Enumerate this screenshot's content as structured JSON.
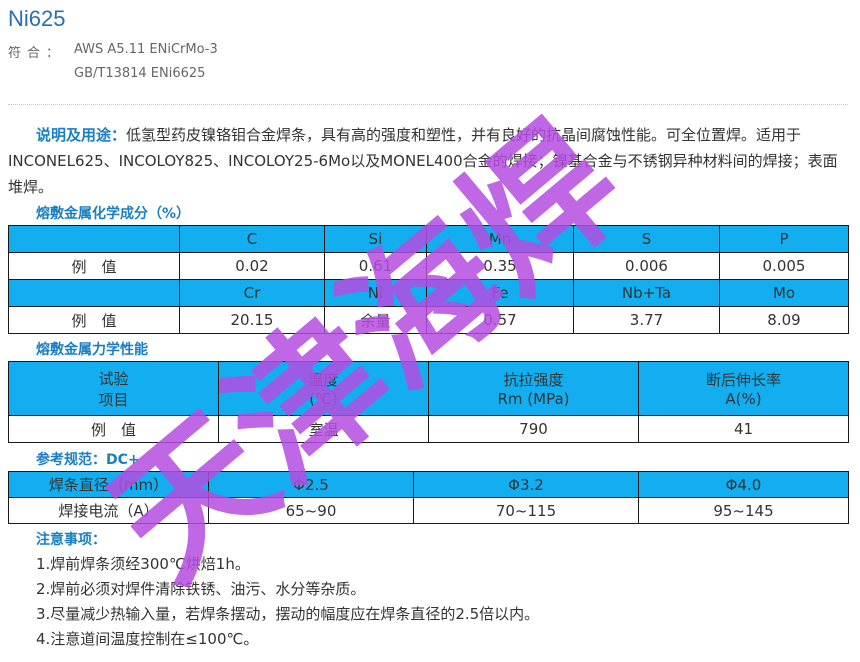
{
  "title": "Ni625",
  "spec": {
    "label": "符合：",
    "line1": "AWS A5.11 ENiCrMo-3",
    "line2": "GB/T13814 ENi6625"
  },
  "description": {
    "lead": "说明及用途：",
    "text": "低氢型药皮镍铬钼合金焊条，具有高的强度和塑性，并有良好的抗晶间腐蚀性能。可全位置焊。适用于INCONEL625、INCOLOY825、INCOLOY25-6Mo以及MONEL400合金的焊接；镍基合金与不锈钢异种材料间的焊接；表面堆焊。"
  },
  "chem": {
    "title": "熔敷金属化学成分（%）",
    "rows": [
      {
        "type": "hd",
        "cells": [
          "",
          "C",
          "Si",
          "Mn",
          "S",
          "P"
        ]
      },
      {
        "type": "bd",
        "cells": [
          "例　值",
          "0.02",
          "0.61",
          "0.35",
          "0.006",
          "0.005"
        ]
      },
      {
        "type": "hd",
        "cells": [
          "",
          "Cr",
          "Ni",
          "Fe",
          "Nb+Ta",
          "Mo"
        ]
      },
      {
        "type": "bd",
        "cells": [
          "例　值",
          "20.15",
          "余量",
          "0.57",
          "3.77",
          "8.09"
        ]
      }
    ]
  },
  "mech": {
    "title": "熔敷金属力学性能",
    "header": {
      "c1a": "试验",
      "c1b": "项目",
      "c2a": "温度",
      "c2b": "(℃)",
      "c3a": "抗拉强度",
      "c3b": "Rm (MPa)",
      "c4a": "断后伸长率",
      "c4b": "A(%)"
    },
    "row": [
      "例　值",
      "室温",
      "790",
      "41"
    ]
  },
  "current": {
    "title": "参考规范：DC+",
    "rows": [
      {
        "type": "hd",
        "cells": [
          "焊条直径（mm）",
          "Φ2.5",
          "Φ3.2",
          "Φ4.0"
        ]
      },
      {
        "type": "bd",
        "cells": [
          "焊接电流（A）",
          "65~90",
          "70~115",
          "95~145"
        ]
      }
    ]
  },
  "notes": {
    "title": "注意事项：",
    "items": [
      "1.焊前焊条须经300℃烘焙1h。",
      "2.焊前必须对焊件清除铁锈、油污、水分等杂质。",
      "3.尽量减少热输入量，若焊条摆动，摆动的幅度应在焊条直径的2.5倍以内。",
      "4.注意道间温度控制在≤100℃。"
    ]
  },
  "watermark": {
    "text": "天津海焊",
    "color": "#b44ce0"
  }
}
